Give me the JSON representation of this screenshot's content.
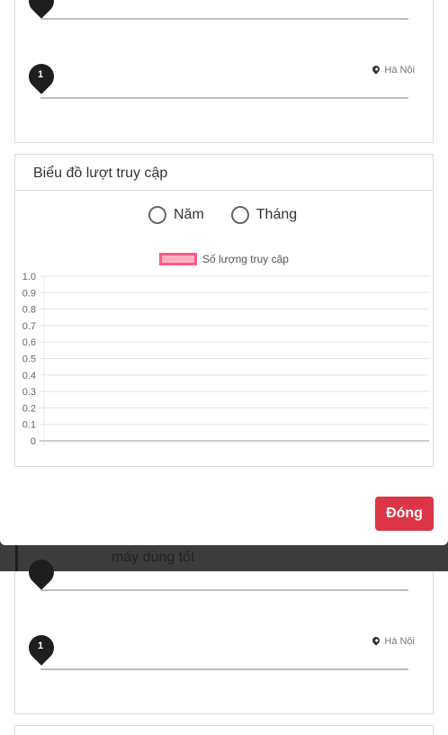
{
  "modal": {
    "location_card": {
      "marker_number": "1",
      "location": "Hà Nội"
    },
    "chart_card": {
      "title": "Biểu đồ lượt truy cập",
      "radio_options": [
        "Năm",
        "Tháng"
      ]
    },
    "close_button_label": "Đóng"
  },
  "background": {
    "product_text": "máy dùng tốt",
    "location_card": {
      "marker_number": "1",
      "location": "Hà Nội"
    }
  },
  "chart_data": {
    "type": "bar",
    "title": "",
    "legend": [
      "Số lượng truy cập"
    ],
    "series": [
      {
        "name": "Số lượng truy cập",
        "values": [],
        "color": "#ffb1c2",
        "border_color": "#ff5b85"
      }
    ],
    "categories": [],
    "ylim": [
      0,
      1.0
    ],
    "yticks": [
      "1.0",
      "0.9",
      "0.8",
      "0.7",
      "0.6",
      "0.5",
      "0.4",
      "0.3",
      "0.2",
      "0.1",
      "0"
    ],
    "grid": true,
    "legend_position": "top"
  },
  "colors": {
    "danger": "#dc3545",
    "overlay": "#3d3d3d",
    "marker": "#1e1e1e"
  }
}
